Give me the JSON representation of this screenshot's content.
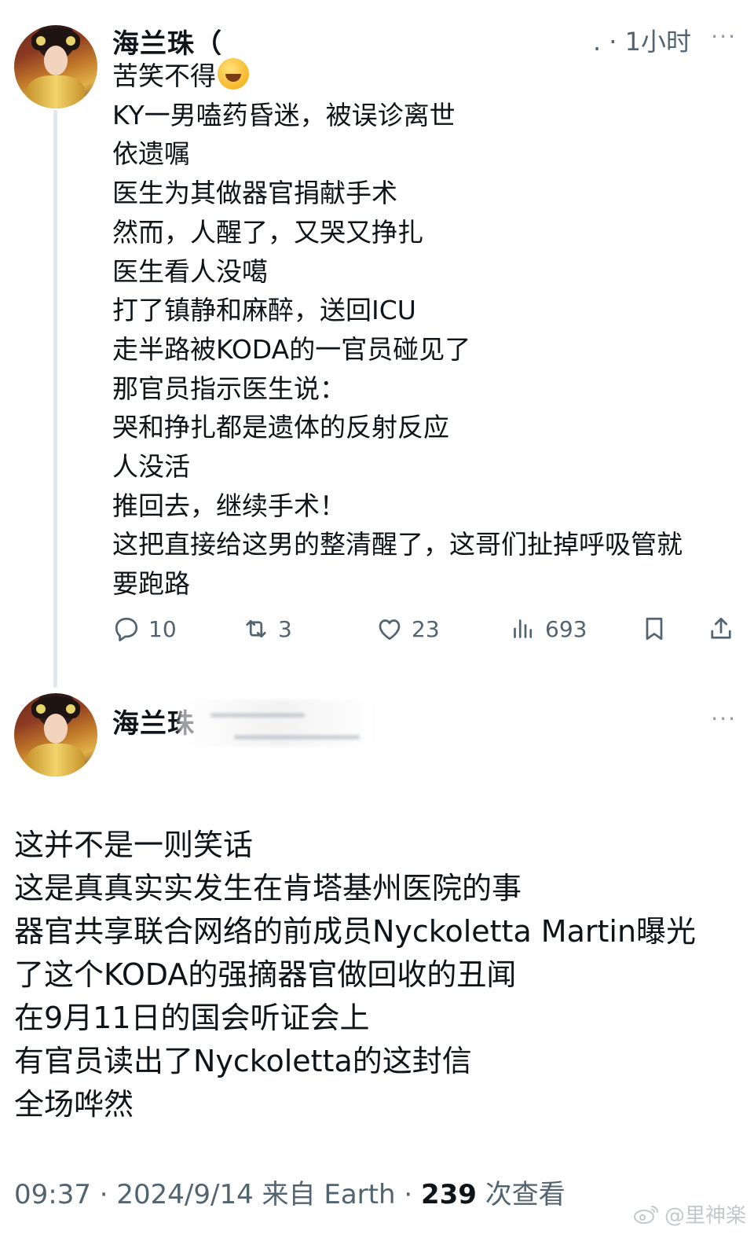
{
  "post1": {
    "author": "海兰珠（",
    "time": ". · 1小时",
    "more": "···",
    "lines": [
      "苦笑不得",
      "KY一男嗑药昏迷，被误诊离世",
      "依遗嘱",
      "医生为其做器官捐献手术",
      "然而，人醒了，又哭又挣扎",
      "医生看人没噶",
      "打了镇静和麻醉，送回ICU",
      "走半路被KODA的一官员碰见了",
      "那官员指示医生说：",
      "哭和挣扎都是遗体的反射反应",
      "人没活",
      "推回去，继续手术！",
      "这把直接给这男的整清醒了，这哥们扯掉呼吸管就",
      "要跑路"
    ],
    "emoji": "rofl-emoji",
    "actions": {
      "reply_count": "10",
      "repost_count": "3",
      "like_count": "23",
      "view_count": "693"
    }
  },
  "post2": {
    "author": "海兰珠",
    "more": "···",
    "body": [
      "这并不是一则笑话",
      "这是真真实实发生在肯塔基州医院的事",
      "器官共享联合网络的前成员Nyckoletta Martin曝光",
      "了这个KODA的强摘器官做回收的丑闻",
      "在9月11日的国会听证会上",
      "有官员读出了Nyckoletta的这封信",
      "全场哗然"
    ],
    "footer": {
      "time": "09:37 · 2024/9/14 来自 Earth · ",
      "views": "239",
      "views_label": " 次查看"
    }
  },
  "watermark": "@里神楽",
  "icons": {
    "reply": "reply-icon",
    "repost": "repost-icon",
    "like": "heart-icon",
    "views": "views-bar-chart-icon",
    "bookmark": "bookmark-icon",
    "share": "share-icon"
  },
  "colors": {
    "text": "#0f1419",
    "secondary": "#536471",
    "thread_line": "#e3e7ea"
  }
}
